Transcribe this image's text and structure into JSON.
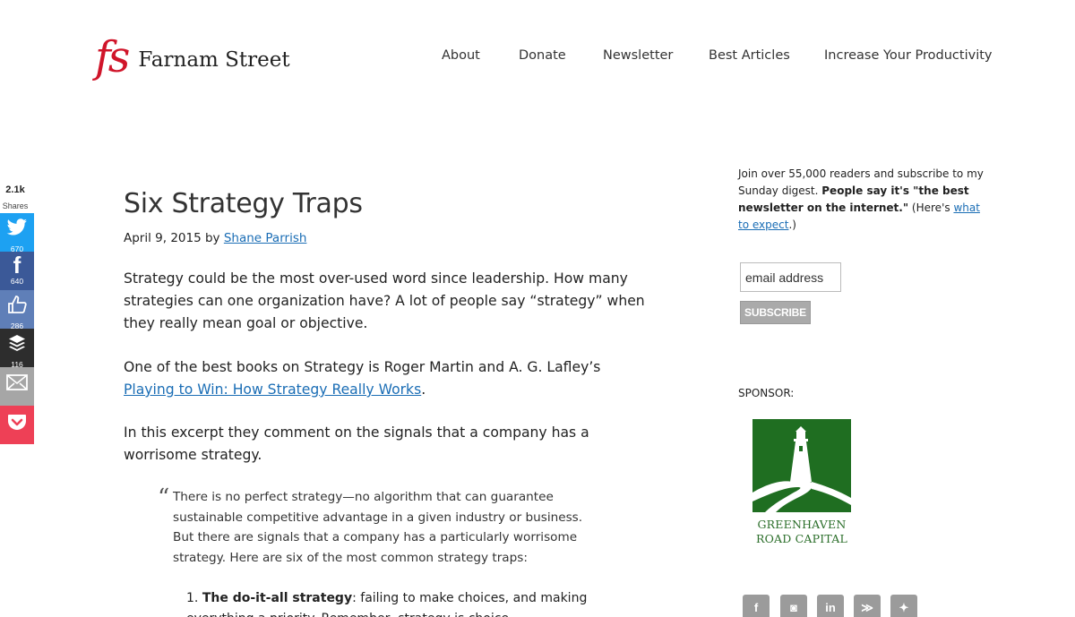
{
  "site": {
    "logo_mark": "fs",
    "name": "Farnam Street"
  },
  "nav": {
    "items": [
      "About",
      "Donate",
      "Newsletter",
      "Best Articles",
      "Increase Your Productivity"
    ]
  },
  "share": {
    "total": "2.1k",
    "label": "Shares",
    "buttons": [
      {
        "icon": "twitter-icon",
        "glyph": "🐦",
        "count": "670",
        "color": "#1da1f2"
      },
      {
        "icon": "facebook-icon",
        "glyph": "f",
        "count": "640",
        "color": "#3b5998"
      },
      {
        "icon": "like-icon",
        "glyph": "👍",
        "count": "286",
        "color": "#5f7fb8"
      },
      {
        "icon": "buffer-icon",
        "glyph": "≋",
        "count": "116",
        "color": "#2d2d2d"
      },
      {
        "icon": "email-icon",
        "glyph": "✉",
        "count": "",
        "color": "#999999"
      },
      {
        "icon": "pocket-icon",
        "glyph": "♥",
        "count": "",
        "color": "#ee4056"
      }
    ]
  },
  "article": {
    "title": "Six Strategy Traps",
    "date": "April 9, 2015",
    "by": "by",
    "author": "Shane Parrish",
    "para1": "Strategy could be the most over-used word since leadership. How many strategies can one organization have? A lot of people say “strategy” when they really mean goal or objective.",
    "para2_pre": "One of the best books on Strategy is Roger Martin and A. G. Lafley’s ",
    "para2_link": "Playing to Win: How Strategy Really Works",
    "para2_post": ".",
    "para3": "In this excerpt they comment on the signals that a company has a worrisome strategy.",
    "quote_mark": "“",
    "quote": "There is no perfect strategy—no algorithm that can guarantee sustainable competitive advantage in a given industry or business. But there are signals that a company has a particularly worrisome strategy. Here are six of the most common strategy traps:",
    "list_num": "1.",
    "list_bold": "The do-it-all strategy",
    "list_rest": ": failing to make choices, and making everything a priority. Remember, strategy is choice."
  },
  "sidebar": {
    "signup_pre": "Join over 55,000 readers and subscribe to my Sunday digest. ",
    "signup_bold": "People say it's \"the best newsletter on the internet.\"",
    "signup_post1": " (Here's ",
    "signup_link": "what to expect",
    "signup_post2": ".)",
    "email_placeholder": "email address",
    "subscribe_label": "SUBSCRIBE",
    "sponsor_label": "SPONSOR:",
    "sponsor_line1": "GREENHAVEN",
    "sponsor_line2": "ROAD CAPITAL",
    "sponsor_color": "#1f6e21",
    "social": [
      {
        "icon": "facebook-icon",
        "glyph": "f"
      },
      {
        "icon": "instagram-icon",
        "glyph": "◙"
      },
      {
        "icon": "linkedin-icon",
        "glyph": "in"
      },
      {
        "icon": "rss-icon",
        "glyph": "≫"
      },
      {
        "icon": "twitter-icon",
        "glyph": "✦"
      }
    ]
  }
}
